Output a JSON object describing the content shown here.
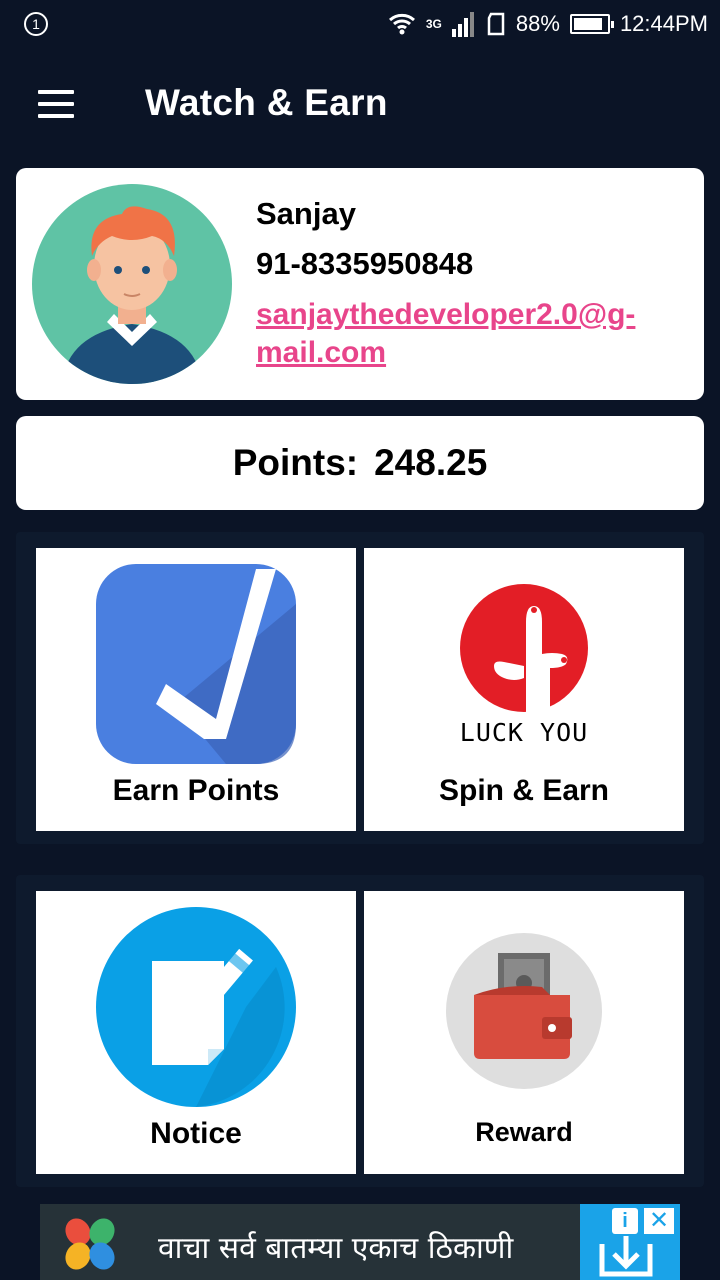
{
  "status_bar": {
    "notification_count": "1",
    "network": "3G",
    "battery": "88%",
    "battery_level": 0.88,
    "time": "12:44PM"
  },
  "app_bar": {
    "title": "Watch & Earn",
    "menu_icon": "hamburger-menu-icon"
  },
  "profile": {
    "name": "Sanjay",
    "phone": "91-8335950848",
    "email_line1": "sanjaythedeveloper2.0@g-",
    "email_line2": "mail.com"
  },
  "points": {
    "label": "Points:",
    "value": "248.25"
  },
  "tiles": [
    {
      "label": "Earn Points",
      "icon": "checkmark-icon"
    },
    {
      "label": "Spin & Earn",
      "icon": "luck-you-icon",
      "icon_text": "LUCK YOU"
    },
    {
      "label": "Notice",
      "icon": "notice-edit-icon"
    },
    {
      "label": "Reward",
      "icon": "wallet-icon"
    }
  ],
  "ad": {
    "text": "वाचा सर्व बातम्या एकाच ठिकाणी",
    "info_label": "i",
    "close_label": "✕"
  },
  "colors": {
    "background": "#0b1426",
    "email_link": "#e8458b",
    "earn_icon_blue": "#4a7fe0",
    "spin_icon_red": "#e31e26",
    "notice_icon_blue": "#0aa0e6",
    "wallet_red": "#d84c3e",
    "ad_cta_blue": "#1aa3e8"
  }
}
